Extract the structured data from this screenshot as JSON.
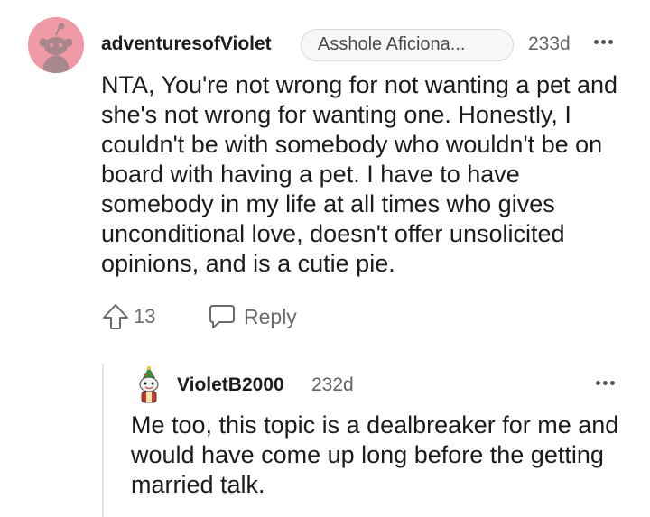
{
  "comment": {
    "username": "adventuresofViolet",
    "flair": "Asshole Aficiona...",
    "time": "233d",
    "body": "NTA, You're not wrong for not wanting a pet and she's not wrong for wanting one. Honestly, I couldn't be with somebody who wouldn't be on board with having a pet. I have to have somebody in my life at all times who gives unconditional love, doesn't offer unsolicited opinions, and is a cutie pie.",
    "votes": "13",
    "reply_label": "Reply",
    "icons": {
      "avatar": "snoo-avatar",
      "upvote": "upvote-arrow-icon",
      "reply": "speech-bubble-icon",
      "more": "more-dots-icon"
    },
    "avatar_color": "#ef9aa4"
  },
  "reply": {
    "username": "VioletB2000",
    "time": "232d",
    "body": "Me too, this topic is a dealbreaker for me and would have come up long before the getting married talk.",
    "icons": {
      "avatar": "custom-avatar",
      "more": "more-dots-icon"
    }
  }
}
